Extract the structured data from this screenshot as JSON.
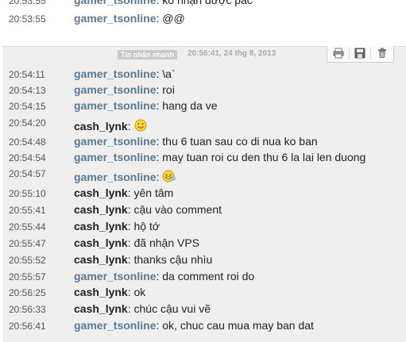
{
  "top_messages": [
    {
      "time": "20:53:55",
      "user": "gamer_tsonline",
      "text": "kổ nhận được pác"
    },
    {
      "time": "20:53:55",
      "user": "gamer_tsonline",
      "text": "@@"
    }
  ],
  "session_header": {
    "label": "Tin nhắn nhanh",
    "date": "20:56:41, 24 thg 8, 2013"
  },
  "messages": [
    {
      "time": "20:54:11",
      "user": "gamer_tsonline",
      "text": "\\a`"
    },
    {
      "time": "20:54:13",
      "user": "gamer_tsonline",
      "text": "roi"
    },
    {
      "time": "20:54:15",
      "user": "gamer_tsonline",
      "text": "hang da ve"
    },
    {
      "time": "20:54:20",
      "user": "cash_lynk",
      "text": ""
    },
    {
      "time": "20:54:48",
      "user": "gamer_tsonline",
      "text": "thu 6 tuan sau co di nua ko ban"
    },
    {
      "time": "20:54:54",
      "user": "gamer_tsonline",
      "text": "may tuan roi cu den thu 6 la lai len duong"
    },
    {
      "time": "20:54:57",
      "user": "gamer_tsonline",
      "text": ""
    },
    {
      "time": "20:55:10",
      "user": "cash_lynk",
      "text": "yên tâm"
    },
    {
      "time": "20:55:41",
      "user": "cash_lynk",
      "text": "cậu vào comment"
    },
    {
      "time": "20:55:44",
      "user": "cash_lynk",
      "text": "hộ tớ"
    },
    {
      "time": "20:55:47",
      "user": "cash_lynk",
      "text": "đã nhận VPS"
    },
    {
      "time": "20:55:52",
      "user": "cash_lynk",
      "text": "thanks cậu nhìu"
    },
    {
      "time": "20:55:57",
      "user": "gamer_tsonline",
      "text": "da comment roi do"
    },
    {
      "time": "20:56:25",
      "user": "cash_lynk",
      "text": "ok"
    },
    {
      "time": "20:56:33",
      "user": "cash_lynk",
      "text": "chúc cậu vui vẽ"
    },
    {
      "time": "20:56:41",
      "user": "gamer_tsonline",
      "text": "ok, chuc cau mua may ban dat"
    }
  ],
  "toolbar_icons": [
    "print-icon",
    "save-icon",
    "delete-icon"
  ]
}
